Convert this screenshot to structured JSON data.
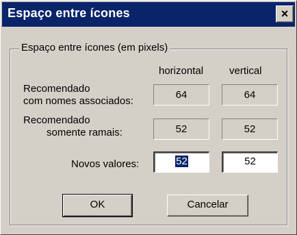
{
  "window": {
    "title": "Espaço entre ícones",
    "close_glyph": "×",
    "colors": {
      "titlebar": "#0a246a",
      "face": "#d4d0c8",
      "selection": "#0a246a"
    }
  },
  "group": {
    "label": "Espaço entre ícones (em pixels)",
    "col_horizontal": "horizontal",
    "col_vertical": "vertical"
  },
  "rows": {
    "recommended_names": {
      "label_line1": "Recomendado",
      "label_line2": "com nomes associados:",
      "horizontal": "64",
      "vertical": "64"
    },
    "recommended_branches": {
      "label_line1": "Recomendado",
      "label_line2": "somente ramais:",
      "horizontal": "52",
      "vertical": "52"
    },
    "new_values": {
      "label": "Novos valores:",
      "horizontal": "52",
      "vertical": "52"
    }
  },
  "buttons": {
    "ok": "OK",
    "cancel": "Cancelar"
  }
}
